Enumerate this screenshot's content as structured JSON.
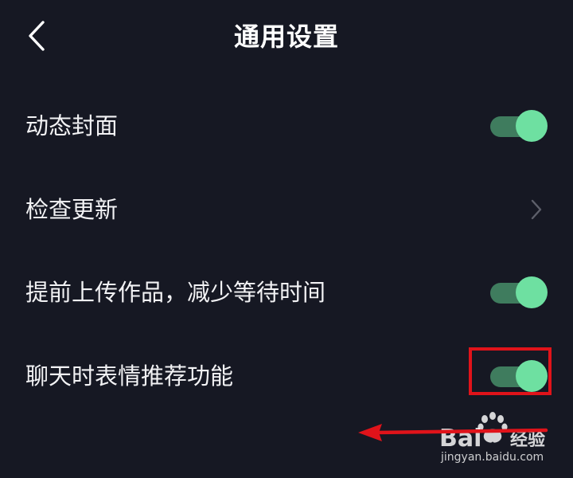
{
  "header": {
    "title": "通用设置",
    "back_icon": "chevron-left-icon"
  },
  "settings": [
    {
      "label": "动态封面",
      "control": "toggle",
      "on": true
    },
    {
      "label": "检查更新",
      "control": "chevron",
      "icon": "chevron-right-icon"
    },
    {
      "label": "提前上传作品，减少等待时间",
      "control": "toggle",
      "on": true
    },
    {
      "label": "聊天时表情推荐功能",
      "control": "toggle",
      "on": true,
      "highlighted": true
    }
  ],
  "colors": {
    "background": "#161823",
    "toggle_track_on": "#3f7c5e",
    "toggle_knob_on": "#6ee0a1",
    "annotation_red": "#e0131a"
  },
  "watermark": {
    "logo_text": "Bai 经验",
    "caption": "jingyan.baidu.com"
  }
}
